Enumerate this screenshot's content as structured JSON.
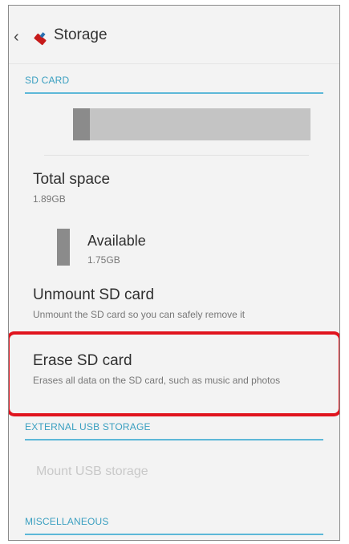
{
  "header": {
    "back_icon": "chevron-left-icon",
    "app_icon": "storage-icon",
    "title": "Storage"
  },
  "sections": {
    "sd_card": "SD CARD",
    "external_usb": "EXTERNAL USB STORAGE",
    "misc": "MISCELLANEOUS"
  },
  "storage_bar": {
    "used_fraction": 0.07
  },
  "items": {
    "total_space": {
      "title": "Total space",
      "value": "1.89GB"
    },
    "available": {
      "title": "Available",
      "value": "1.75GB"
    },
    "unmount": {
      "title": "Unmount SD card",
      "summary": "Unmount the SD card so you can safely remove it"
    },
    "erase": {
      "title": "Erase SD card",
      "summary": "Erases all data on the SD card, such as music and photos"
    },
    "mount_usb": {
      "title": "Mount USB storage"
    }
  },
  "colors": {
    "accent": "#3a9fc0",
    "highlight": "#e0141e",
    "bar_used": "#8b8b8b",
    "bar_free": "#c4c4c4"
  }
}
